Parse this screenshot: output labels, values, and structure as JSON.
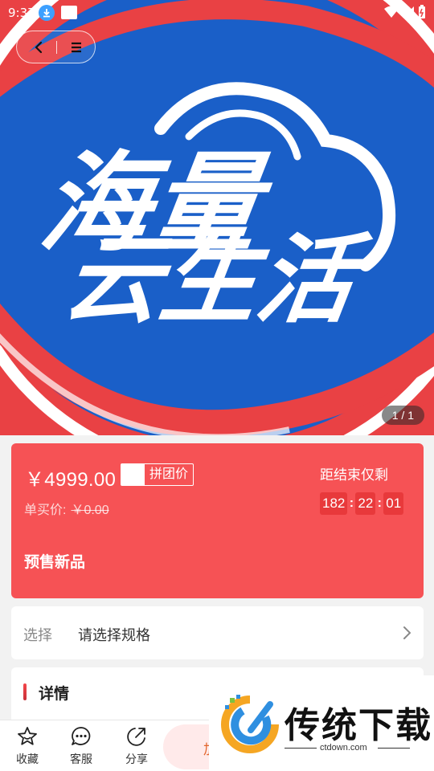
{
  "status_bar": {
    "time": "9:37"
  },
  "hero": {
    "logo_line1": "海量",
    "logo_line2": "云生活",
    "image_counter": "1 / 1",
    "colors": {
      "red": "#e94144",
      "blue": "#1a5fc8",
      "white": "#ffffff"
    }
  },
  "nav": {
    "back_icon": "chevron-left-icon",
    "menu_icon": "menu-icon"
  },
  "price_card": {
    "price": "￥4999.00",
    "group_tag": "拼团价",
    "single_price_label": "单买价:",
    "single_price_value": "￥0.00",
    "countdown_label": "距结束仅剩",
    "countdown": {
      "hours": "182",
      "minutes": "22",
      "seconds": "01"
    },
    "presale_label": "预售新品",
    "background_color": "#f65255"
  },
  "spec": {
    "label": "选择",
    "value": "请选择规格"
  },
  "details": {
    "title": "详情"
  },
  "bottom_bar": {
    "favorite": "收藏",
    "service": "客服",
    "share": "分享",
    "buy_partial": "加"
  },
  "watermark": {
    "brand": "传统下载",
    "domain": "ctdown.com"
  }
}
